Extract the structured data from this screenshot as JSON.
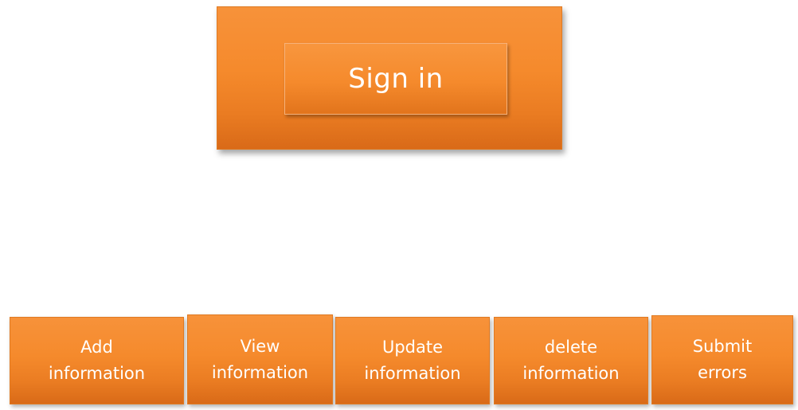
{
  "signin": {
    "label": "Sign in"
  },
  "menu": {
    "items": [
      {
        "id": "add",
        "label": "Add\ninformation"
      },
      {
        "id": "view",
        "label": "View\ninformation"
      },
      {
        "id": "update",
        "label": "Update\ninformation"
      },
      {
        "id": "delete",
        "label": "delete\ninformation"
      },
      {
        "id": "submit",
        "label": "Submit\nerrors"
      }
    ]
  },
  "colors": {
    "accent": "#f58a2c",
    "accent_dark": "#d96a18",
    "text": "#ffffff",
    "background": "#ffffff"
  }
}
